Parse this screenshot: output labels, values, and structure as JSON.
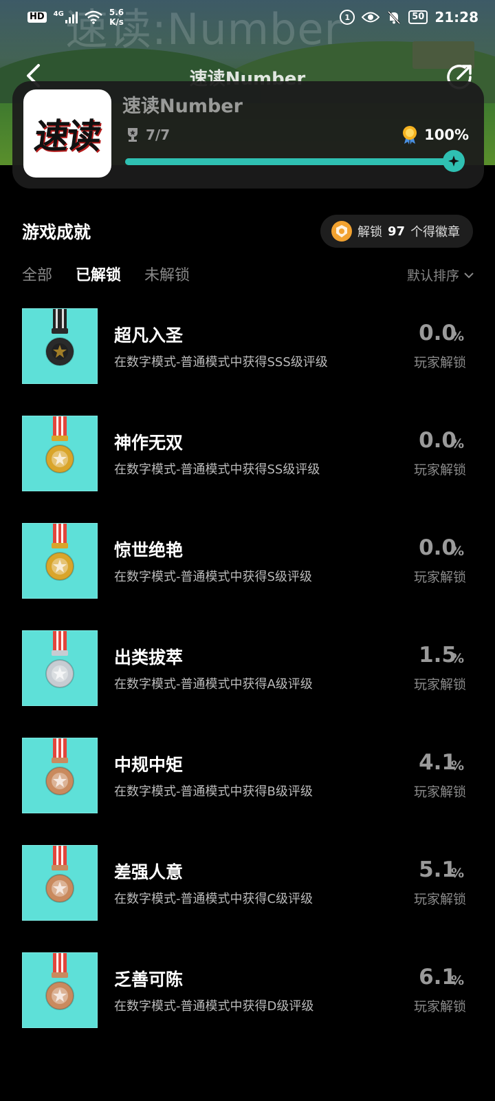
{
  "status_bar": {
    "hd": "HD",
    "network": "4G",
    "speed_value": "5.6",
    "speed_unit": "K/s",
    "battery": "50",
    "time": "21:28"
  },
  "hero": {
    "watermark": "速读:Number"
  },
  "nav": {
    "title": "速读Number"
  },
  "game": {
    "icon_text": "速读",
    "name": "速读Number",
    "trophies": "7/7",
    "percent": "100%",
    "progress": 1.0
  },
  "section": {
    "title": "游戏成就",
    "badge_prefix": "解锁",
    "badge_count": "97",
    "badge_suffix": "个得徽章"
  },
  "tabs": [
    {
      "label": "全部",
      "active": false
    },
    {
      "label": "已解锁",
      "active": true
    },
    {
      "label": "未解锁",
      "active": false
    }
  ],
  "sort_label": "默认排序",
  "achievements": [
    {
      "name": "超凡入圣",
      "desc": "在数字模式-普通模式中获得SSS级评级",
      "pct": "0.0",
      "pct_sym": "%",
      "sub": "玩家解锁",
      "medal": "black"
    },
    {
      "name": "神作无双",
      "desc": "在数字模式-普通模式中获得SS级评级",
      "pct": "0.0",
      "pct_sym": "%",
      "sub": "玩家解锁",
      "medal": "gold"
    },
    {
      "name": "惊世绝艳",
      "desc": "在数字模式-普通模式中获得S级评级",
      "pct": "0.0",
      "pct_sym": "%",
      "sub": "玩家解锁",
      "medal": "gold"
    },
    {
      "name": "出类拔萃",
      "desc": "在数字模式-普通模式中获得A级评级",
      "pct": "1.5",
      "pct_sym": "%",
      "sub": "玩家解锁",
      "medal": "silver"
    },
    {
      "name": "中规中矩",
      "desc": "在数字模式-普通模式中获得B级评级",
      "pct": "4.1",
      "pct_sym": "%",
      "sub": "玩家解锁",
      "medal": "bronze"
    },
    {
      "name": "差强人意",
      "desc": "在数字模式-普通模式中获得C级评级",
      "pct": "5.1",
      "pct_sym": "%",
      "sub": "玩家解锁",
      "medal": "bronze"
    },
    {
      "name": "乏善可陈",
      "desc": "在数字模式-普通模式中获得D级评级",
      "pct": "6.1",
      "pct_sym": "%",
      "sub": "玩家解锁",
      "medal": "bronze"
    }
  ],
  "colors": {
    "accent": "#2fc0b2",
    "medal_bg": "#5ee0d8",
    "gold": "#d9a52b",
    "silver": "#c7ccd2",
    "bronze": "#c98a5e",
    "black": "#2a2a2a"
  }
}
